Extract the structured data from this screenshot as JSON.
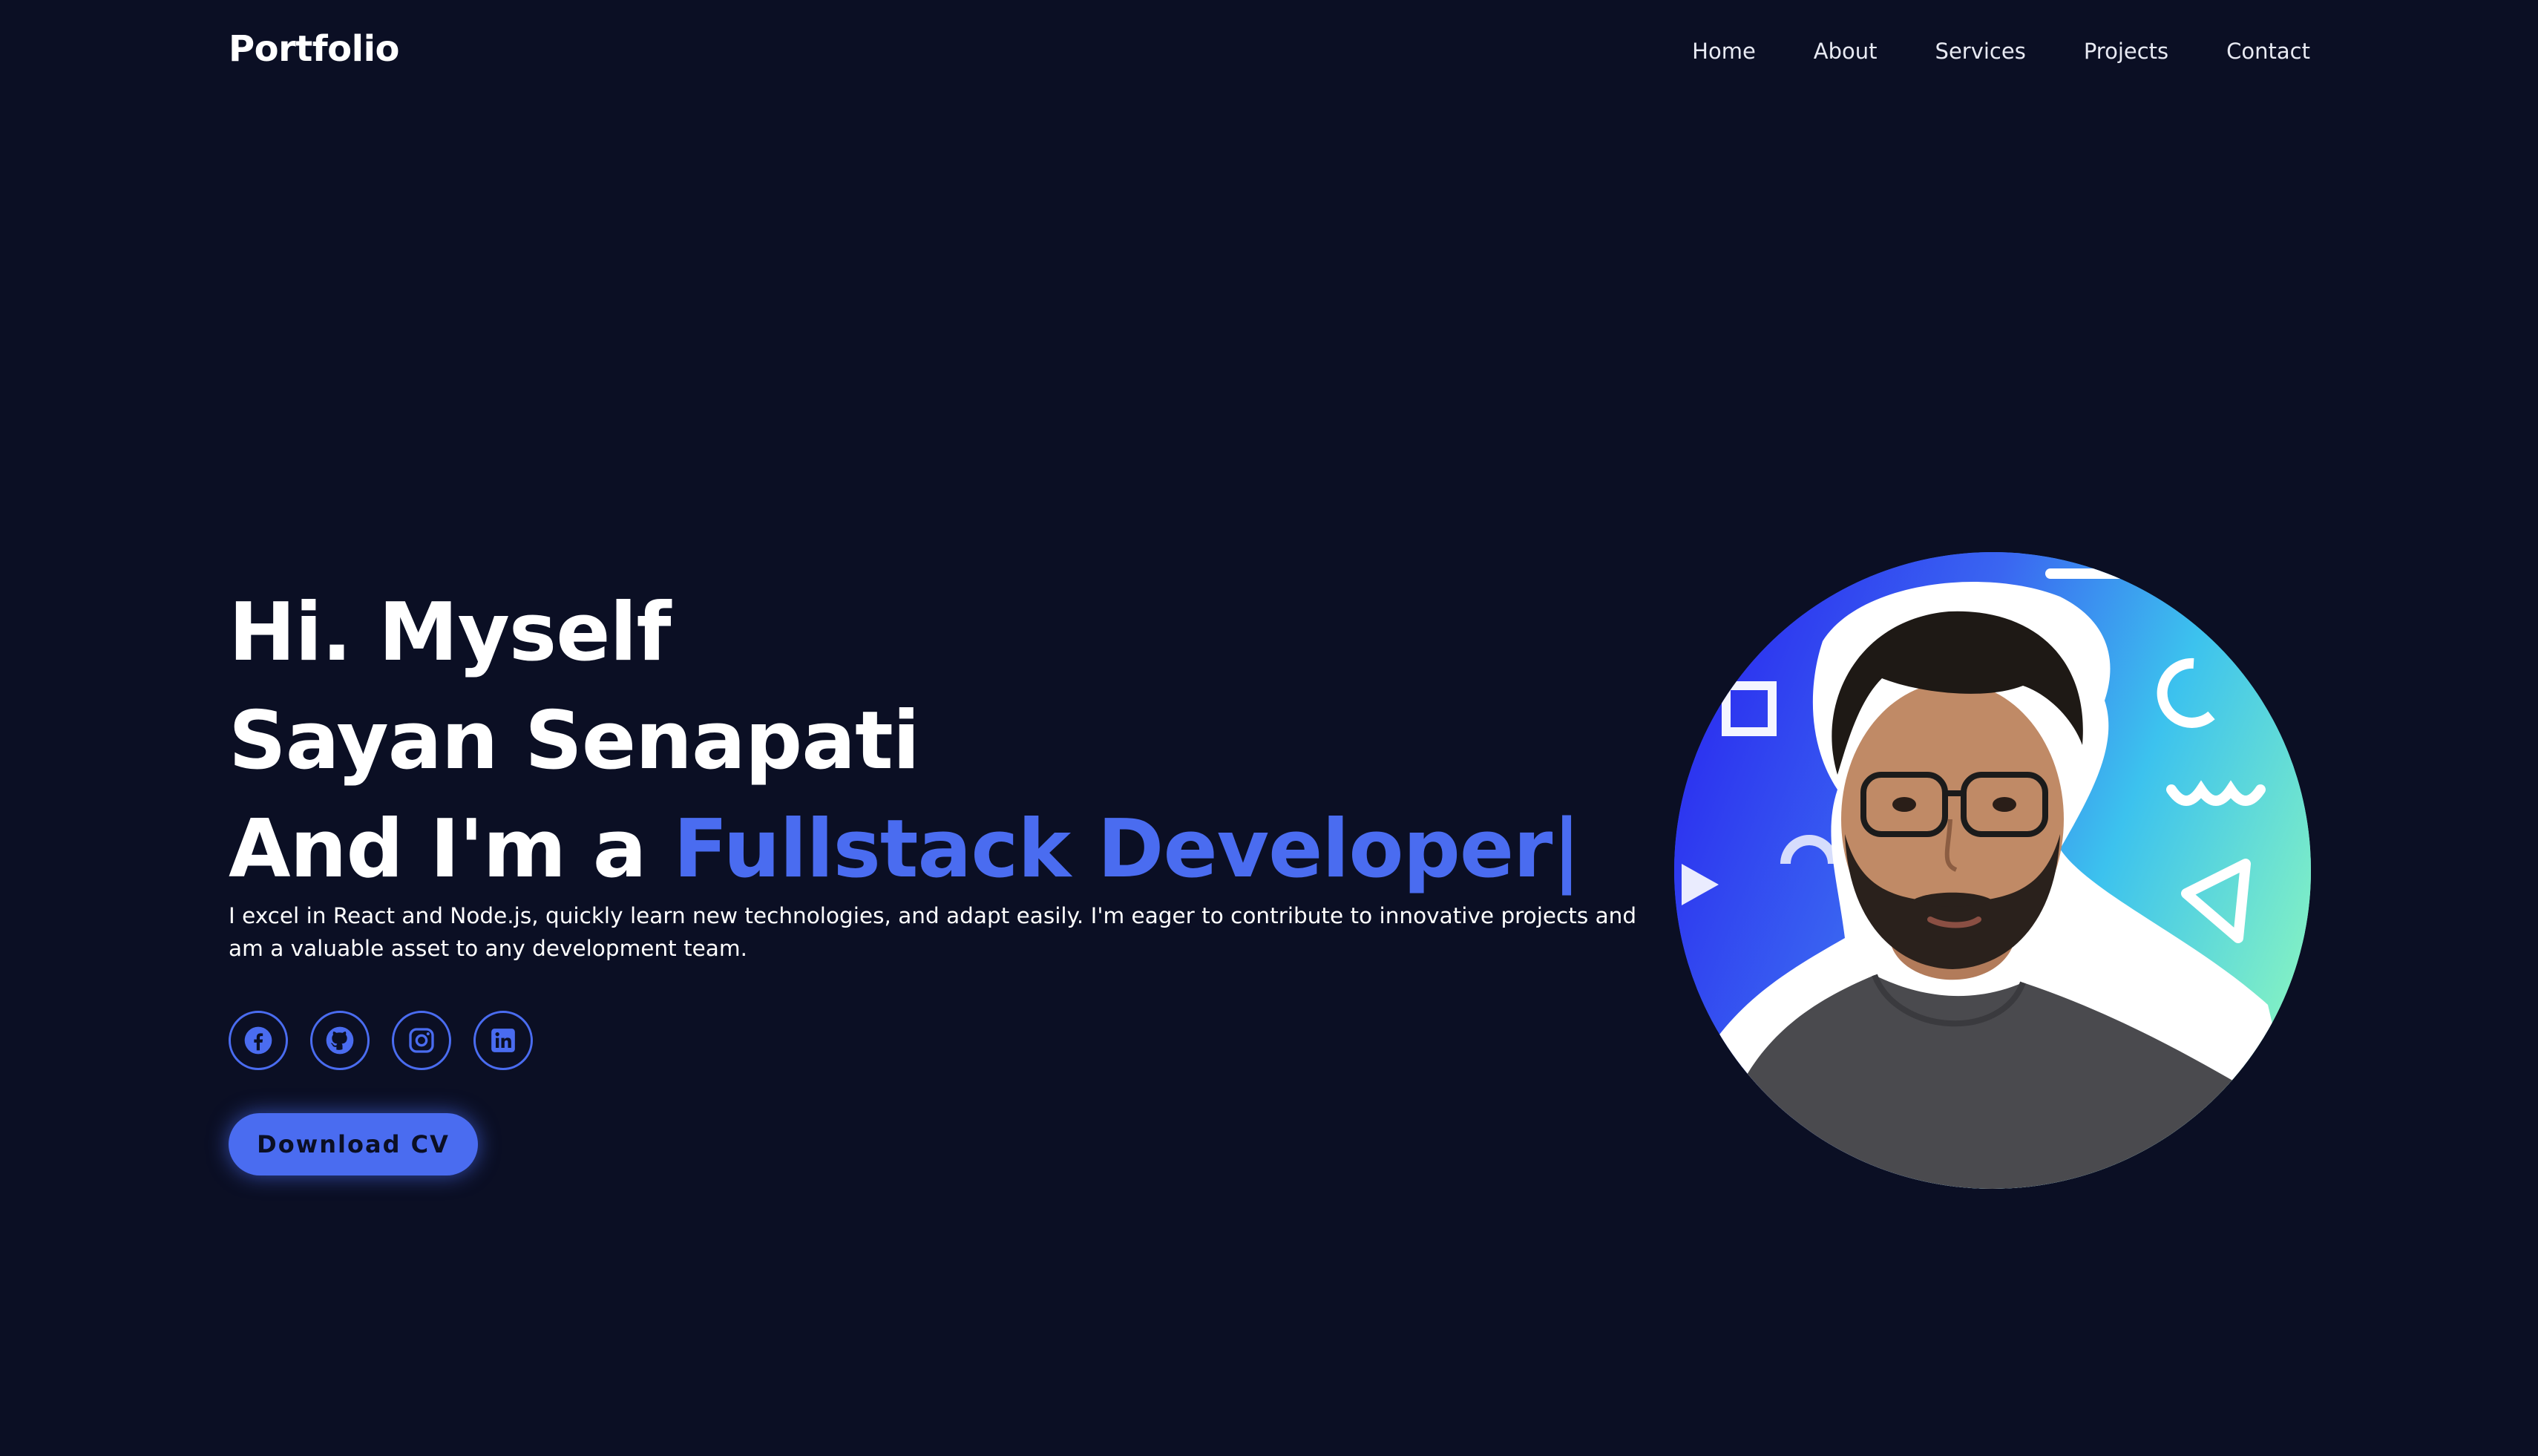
{
  "header": {
    "logo": "Portfolio",
    "nav": [
      "Home",
      "About",
      "Services",
      "Projects",
      "Contact"
    ]
  },
  "hero": {
    "line1": "Hi. Myself",
    "line2": "Sayan Senapati",
    "line3_prefix": "And I'm a ",
    "line3_accent": "Fullstack Developer",
    "caret": "|",
    "description": "I excel in React and Node.js, quickly learn new technologies, and adapt easily. I'm eager to contribute to innovative projects and am a valuable asset to any development team.",
    "socials": [
      "facebook-icon",
      "github-icon",
      "instagram-icon",
      "linkedin-icon"
    ],
    "cta_label": "Download CV"
  },
  "colors": {
    "background": "#0b0f24",
    "accent": "#4a6cf0",
    "text": "#ffffff"
  }
}
